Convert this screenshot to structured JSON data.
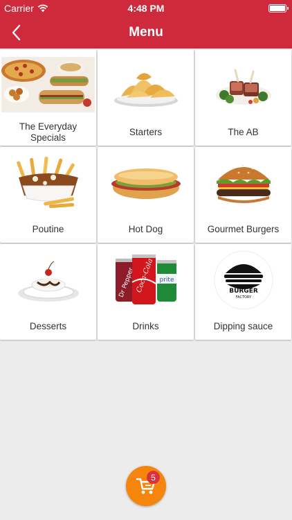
{
  "status_bar": {
    "carrier": "Carrier",
    "time": "4:48 PM"
  },
  "nav": {
    "title": "Menu",
    "back_icon": "chevron-left-icon"
  },
  "categories": [
    {
      "label": "The Everyday Specials",
      "icon": "everyday-specials-image"
    },
    {
      "label": "Starters",
      "icon": "starters-image"
    },
    {
      "label": "The AB",
      "icon": "the-ab-image"
    },
    {
      "label": "Poutine",
      "icon": "poutine-image"
    },
    {
      "label": "Hot Dog",
      "icon": "hot-dog-image"
    },
    {
      "label": "Gourmet Burgers",
      "icon": "gourmet-burgers-image"
    },
    {
      "label": "Desserts",
      "icon": "desserts-image"
    },
    {
      "label": "Drinks",
      "icon": "drinks-image"
    },
    {
      "label": "Dipping sauce",
      "icon": "dipping-sauce-image"
    }
  ],
  "cart": {
    "count": "5",
    "icon": "cart-icon"
  },
  "logo": {
    "text": "BURGER",
    "tagline": "FACTORY"
  },
  "colors": {
    "header": "#cf2a3b",
    "cart": "#f5850c",
    "badge": "#d9323c",
    "background": "#ececec"
  }
}
